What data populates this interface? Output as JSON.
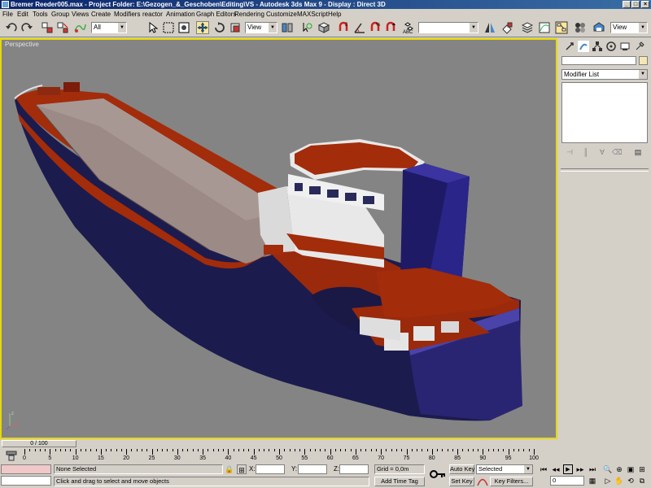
{
  "window": {
    "title": "Bremer Reeder005.max  - Project Folder: E:\\Gezogen_&_Geschoben\\Editing\\VS    - Autodesk 3ds Max 9    - Display : Direct 3D",
    "minimize": "_",
    "maximize": "□",
    "close": "×"
  },
  "menu": [
    "File",
    "Edit",
    "Tools",
    "Group",
    "Views",
    "Create",
    "Modifiers",
    "reactor",
    "Animation",
    "Graph Editors",
    "Rendering",
    "Customize",
    "MAXScript",
    "Help"
  ],
  "toolbar": {
    "selection_filter": "All",
    "ref_coord": "View",
    "named_selection": "",
    "render_view": "View"
  },
  "viewport": {
    "label": "Perspective"
  },
  "command_panel": {
    "modifier_list": "Modifier List"
  },
  "timeline": {
    "slider": "0 / 100",
    "ticks": [
      "0",
      "5",
      "10",
      "15",
      "20",
      "25",
      "30",
      "35",
      "40",
      "45",
      "50",
      "55",
      "60",
      "65",
      "70",
      "75",
      "80",
      "85",
      "90",
      "95",
      "100"
    ]
  },
  "status": {
    "selection": "None Selected",
    "prompt": "Click and drag to select and move objects",
    "x_label": "X:",
    "y_label": "Y:",
    "z_label": "Z:",
    "x_value": "",
    "y_value": "",
    "z_value": "",
    "grid": "Grid = 0,0m",
    "add_time_tag": "Add Time Tag",
    "auto_key": "Auto Key",
    "set_key": "Set Key",
    "key_mode": "Selected",
    "key_filters": "Key Filters...",
    "frame": "0"
  },
  "colors": {
    "accent": "#e8d800",
    "hull": "#1c1b4e",
    "deck": "#a32c0a"
  }
}
